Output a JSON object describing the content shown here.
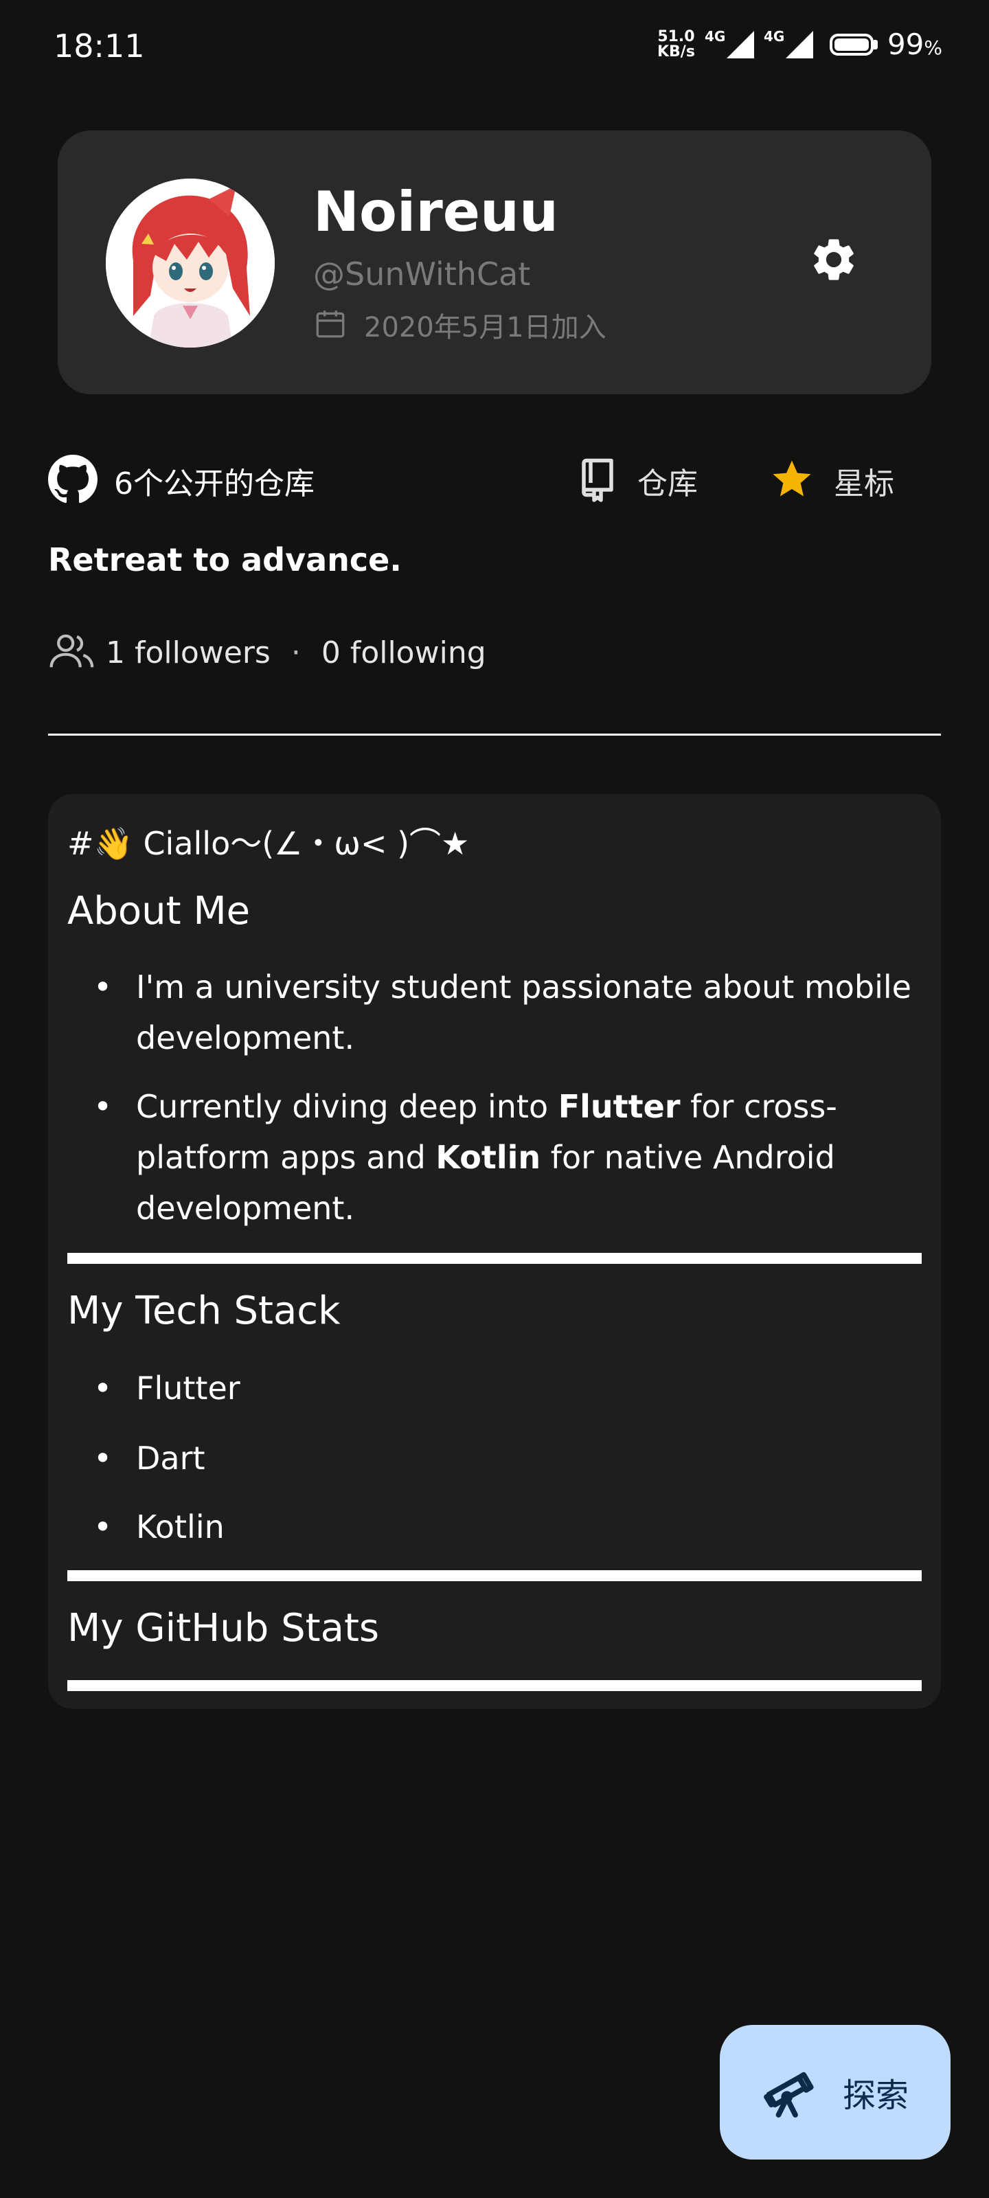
{
  "status_bar": {
    "time": "18:11",
    "net_speed_value": "51.0",
    "net_speed_unit": "KB/s",
    "signal1_label": "4G",
    "signal2_label": "4G",
    "battery_percent": "99",
    "battery_symbol": "%"
  },
  "profile": {
    "display_name": "Noireuu",
    "handle": "@SunWithCat",
    "joined": "2020年5月1日加入"
  },
  "repo_row": {
    "public_repos": "6个公开的仓库",
    "repos_label": "仓库",
    "stars_label": "星标"
  },
  "bio": "Retreat to advance.",
  "follow": {
    "followers": "1 followers",
    "separator": "·",
    "following": "0 following"
  },
  "readme": {
    "greeting": "#👋 Ciallo～(∠・ω< )⌒★",
    "about_heading": "About Me",
    "about_item1": "I'm a university student passionate about mobile development.",
    "about_item2_a": "Currently diving deep into ",
    "about_item2_b": "Flutter",
    "about_item2_c": " for cross-platform apps and ",
    "about_item2_d": "Kotlin",
    "about_item2_e": " for native Android development.",
    "tech_heading": "My Tech Stack",
    "tech_items": [
      "Flutter",
      "Dart",
      "Kotlin"
    ],
    "stats_heading": "My GitHub Stats"
  },
  "fab": {
    "label": "探索"
  },
  "colors": {
    "background": "#121212",
    "card": "#2a2a2a",
    "readme_card": "#1e1e1e",
    "star": "#f5b400",
    "fab": "#bfdcff",
    "muted_text": "#7a7a7a"
  },
  "icons": {
    "settings": "gear-icon",
    "calendar": "calendar-icon",
    "github": "github-icon",
    "repo": "repo-book-icon",
    "star": "star-icon",
    "people": "people-icon",
    "explore": "telescope-icon"
  }
}
